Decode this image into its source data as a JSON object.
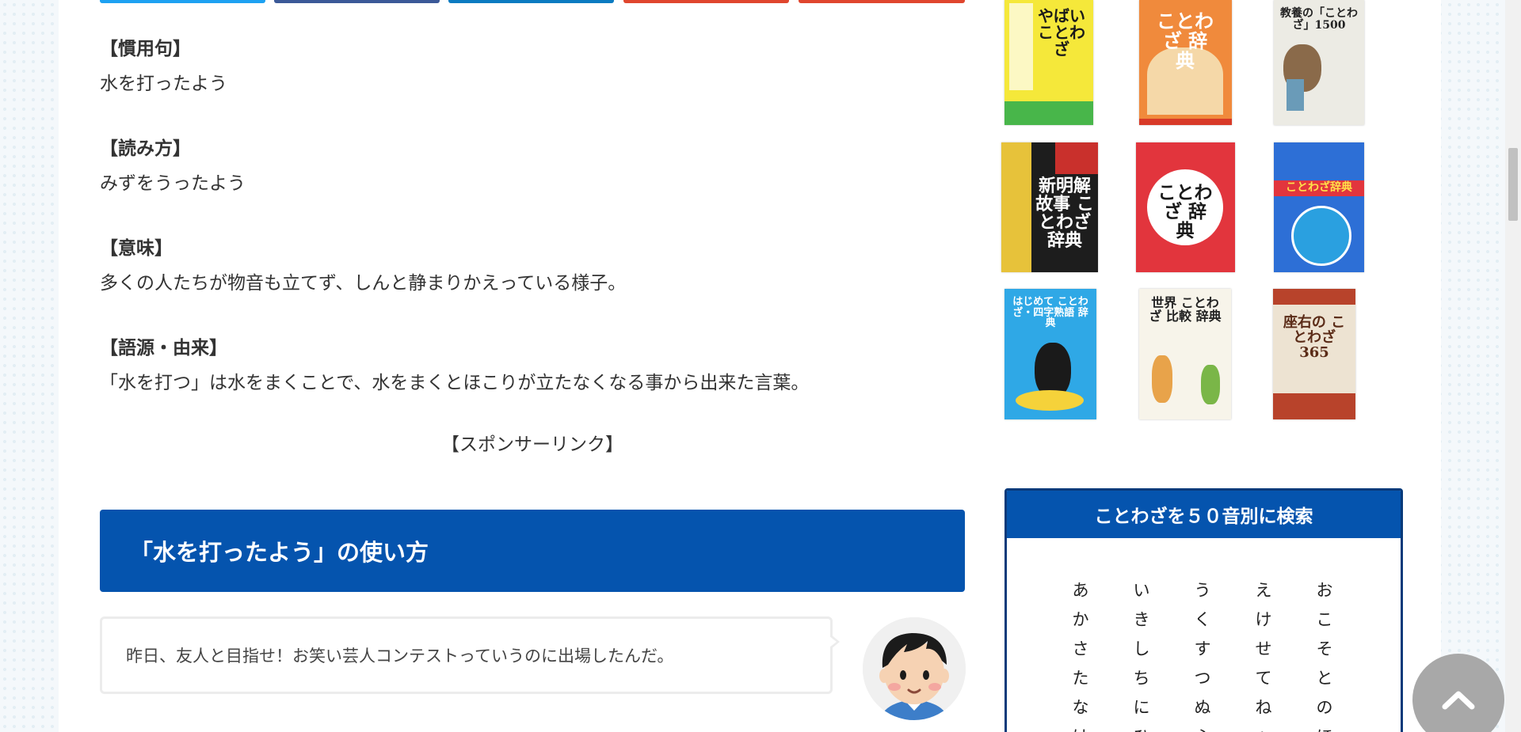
{
  "article": {
    "idiom_label": "【慣用句】",
    "idiom_text": "水を打ったよう",
    "reading_label": "【読み方】",
    "reading_text": "みずをうったよう",
    "meaning_label": "【意味】",
    "meaning_text": "多くの人たちが物音も立てず、しんと静まりかえっている様子。",
    "origin_label": "【語源・由来】",
    "origin_text": "「水を打つ」は水をまくことで、水をまくとほこりが立たなくなる事から出来た言葉。",
    "sponsor_text": "【スポンサーリンク】",
    "usage_heading": "「水を打ったよう」の使い方",
    "dialog_text": "昨日、友人と目指せ！お笑い芸人コンテストっていうのに出場したんだ。"
  },
  "sidebar": {
    "books": [
      {
        "title": "やばい ことわざ",
        "bg": "#f5e83a",
        "fg": "#1a1a1a"
      },
      {
        "title": "ことわざ 辞典",
        "bg": "#f08a3c",
        "fg": "#ffffff"
      },
      {
        "title": "教養の「ことわざ」1500",
        "bg": "#ecebe4",
        "fg": "#222222"
      },
      {
        "title": "新明解 故事 ことわざ 辞典",
        "bg": "#1d1d1d",
        "fg": "#ffffff"
      },
      {
        "title": "ことわざ 辞典",
        "bg": "#e2353d",
        "fg": "#1a1a1a"
      },
      {
        "title": "ことわざ辞典",
        "bg": "#2d6fd6",
        "fg": "#ffe14a"
      },
      {
        "title": "はじめて ことわざ・四字熟語 辞典",
        "bg": "#2fa8e6",
        "fg": "#ffffff"
      },
      {
        "title": "世界 ことわざ 比較 辞典",
        "bg": "#f7f4ea",
        "fg": "#222222"
      },
      {
        "title": "座右の ことわざ 365",
        "bg": "#ede3d2",
        "fg": "#5a2b17"
      }
    ],
    "kana_search": {
      "title": "ことわざを５０音別に検索",
      "columns": [
        [
          "あ",
          "か",
          "さ",
          "た",
          "な",
          "は"
        ],
        [
          "い",
          "き",
          "し",
          "ち",
          "に",
          "ひ"
        ],
        [
          "う",
          "く",
          "す",
          "つ",
          "ぬ",
          "ふ"
        ],
        [
          "え",
          "け",
          "せ",
          "て",
          "ね",
          "へ"
        ],
        [
          "お",
          "こ",
          "そ",
          "と",
          "の",
          "ほ"
        ]
      ]
    }
  },
  "colors": {
    "heading_blue": "#0554ae",
    "box_border": "#083a7a",
    "share_colors": [
      "#1da1f2",
      "#3b5998",
      "#0b7bc1",
      "#e0462e",
      "#e0462e"
    ]
  }
}
